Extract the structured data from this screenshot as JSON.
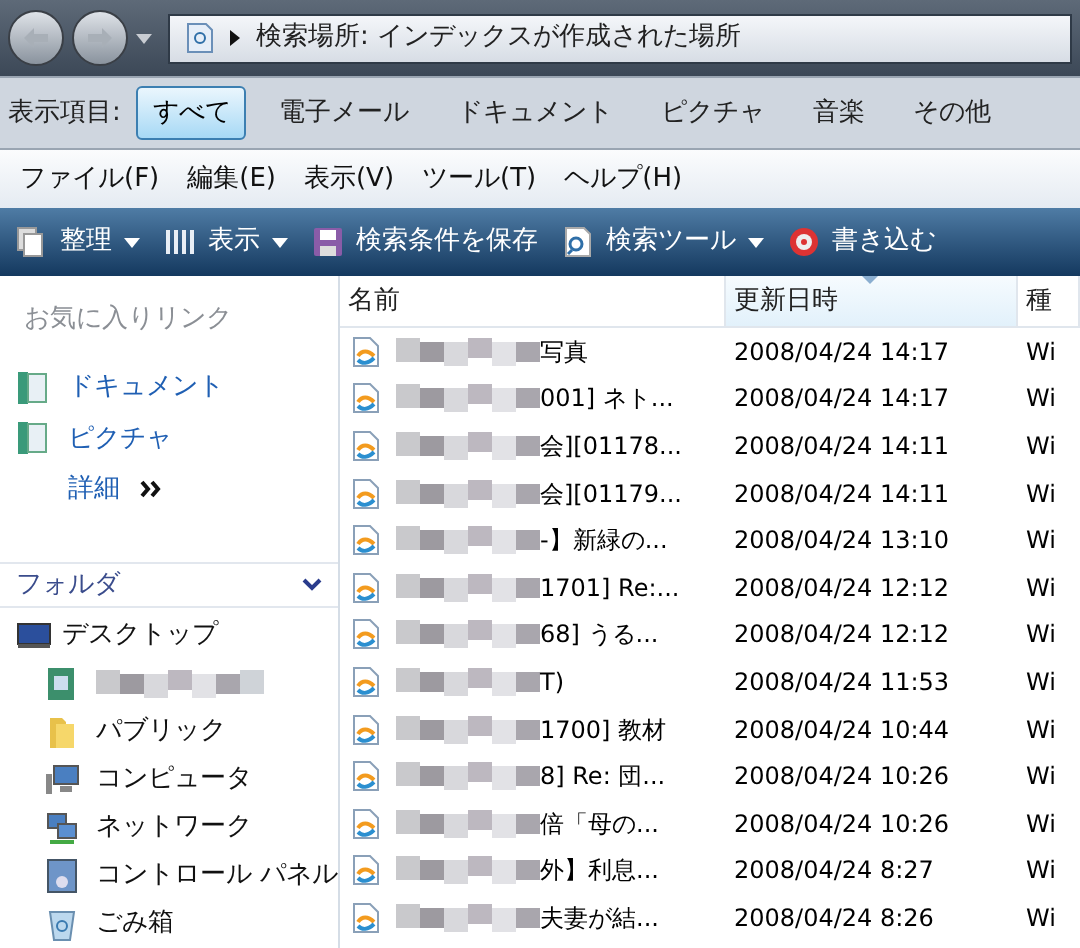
{
  "address": {
    "path": "検索場所: インデックスが作成された場所"
  },
  "filter_bar": {
    "label": "表示項目:",
    "tabs": [
      {
        "label": "すべて",
        "selected": true
      },
      {
        "label": "電子メール",
        "selected": false
      },
      {
        "label": "ドキュメント",
        "selected": false
      },
      {
        "label": "ピクチャ",
        "selected": false
      },
      {
        "label": "音楽",
        "selected": false
      },
      {
        "label": "その他",
        "selected": false
      }
    ]
  },
  "menu": [
    "ファイル(F)",
    "編集(E)",
    "表示(V)",
    "ツール(T)",
    "ヘルプ(H)"
  ],
  "toolbar": [
    {
      "label": "整理",
      "kind": "organize",
      "dropdown": true
    },
    {
      "label": "表示",
      "kind": "views",
      "dropdown": true
    },
    {
      "label": "検索条件を保存",
      "kind": "save",
      "dropdown": false
    },
    {
      "label": "検索ツール",
      "kind": "searchtools",
      "dropdown": true
    },
    {
      "label": "書き込む",
      "kind": "burn",
      "dropdown": false
    }
  ],
  "favorites": {
    "title": "お気に入りリンク",
    "links": [
      {
        "label": "ドキュメント"
      },
      {
        "label": "ピクチャ"
      }
    ],
    "more": "詳細"
  },
  "folders": {
    "title": "フォルダ",
    "expanded": true,
    "items": [
      {
        "kind": "desktop",
        "label": "デスクトップ",
        "children": [
          {
            "kind": "user"
          },
          {
            "kind": "public",
            "label": "パブリック"
          },
          {
            "kind": "computer",
            "label": "コンピュータ"
          },
          {
            "kind": "network",
            "label": "ネットワーク"
          },
          {
            "kind": "control",
            "label": "コントロール パネル"
          },
          {
            "kind": "recycle",
            "label": "ごみ箱"
          }
        ]
      }
    ]
  },
  "table": {
    "columns": [
      {
        "label": "名前",
        "sorted": false
      },
      {
        "label": "更新日時",
        "sorted": true
      },
      {
        "label": "種",
        "sorted": false
      }
    ],
    "rows": [
      {
        "name": "写真",
        "modified": "2008/04/24 14:17",
        "type": "Wi"
      },
      {
        "name": "001] ネト...",
        "modified": "2008/04/24 14:17",
        "type": "Wi"
      },
      {
        "name": "会][01178...",
        "modified": "2008/04/24 14:11",
        "type": "Wi"
      },
      {
        "name": "会][01179...",
        "modified": "2008/04/24 14:11",
        "type": "Wi"
      },
      {
        "name": "-】新緑の...",
        "modified": "2008/04/24 13:10",
        "type": "Wi"
      },
      {
        "name": "1701] Re:...",
        "modified": "2008/04/24 12:12",
        "type": "Wi"
      },
      {
        "name": "68] うる...",
        "modified": "2008/04/24 12:12",
        "type": "Wi"
      },
      {
        "name": "T)",
        "modified": "2008/04/24 11:53",
        "type": "Wi"
      },
      {
        "name": "1700] 教材",
        "modified": "2008/04/24 10:44",
        "type": "Wi"
      },
      {
        "name": "8] Re: 団...",
        "modified": "2008/04/24 10:26",
        "type": "Wi"
      },
      {
        "name": "倍「母の...",
        "modified": "2008/04/24 10:26",
        "type": "Wi"
      },
      {
        "name": "外】利息...",
        "modified": "2008/04/24 8:27",
        "type": "Wi"
      },
      {
        "name": "夫妻が結...",
        "modified": "2008/04/24 8:26",
        "type": "Wi"
      }
    ]
  }
}
